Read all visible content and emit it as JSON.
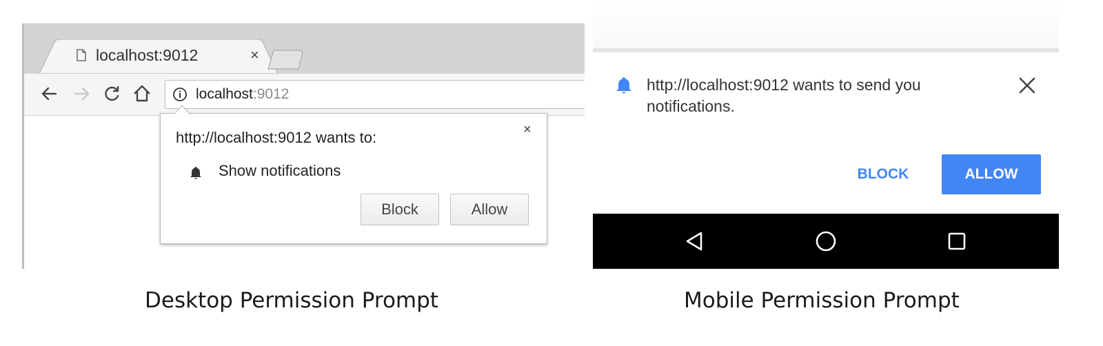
{
  "desktop": {
    "tab": {
      "title": "localhost:9012",
      "close": "×"
    },
    "omnibox": {
      "host": "localhost",
      "port": ":9012"
    },
    "bubble": {
      "title": "http://localhost:9012 wants to:",
      "close": "×",
      "permission": "Show notifications",
      "block_label": "Block",
      "allow_label": "Allow"
    },
    "caption": "Desktop Permission Prompt"
  },
  "mobile": {
    "message": "http://localhost:9012 wants to send you notifications.",
    "block_label": "BLOCK",
    "allow_label": "ALLOW",
    "accent_color": "#4285f4",
    "caption": "Mobile Permission Prompt"
  },
  "icons": {
    "desktop": [
      "page-icon",
      "back-arrow-icon",
      "forward-arrow-icon",
      "reload-icon",
      "home-icon",
      "info-icon",
      "bell-icon"
    ],
    "mobile": [
      "bell-icon",
      "close-icon",
      "back-triangle-icon",
      "home-circle-icon",
      "recents-square-icon"
    ]
  }
}
